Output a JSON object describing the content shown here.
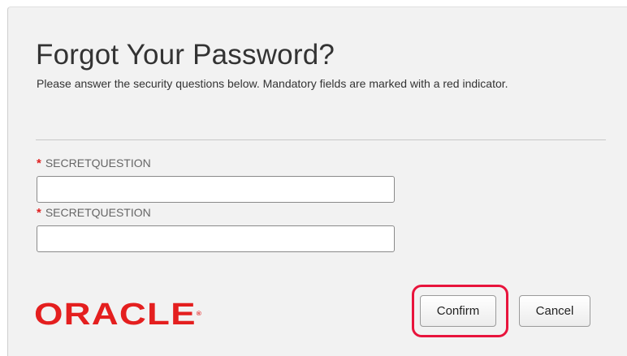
{
  "page": {
    "title": "Forgot Your Password?",
    "subtitle": "Please answer the security questions below. Mandatory fields are marked with a red indicator."
  },
  "form": {
    "required_marker": "*",
    "fields": [
      {
        "label": "SECRETQUESTION",
        "value": "",
        "placeholder": ""
      },
      {
        "label": "SECRETQUESTION",
        "value": "",
        "placeholder": ""
      }
    ]
  },
  "brand": {
    "logo_text": "ORACLE",
    "trademark": "®",
    "color": "#e41f1f"
  },
  "actions": {
    "confirm_label": "Confirm",
    "cancel_label": "Cancel"
  },
  "annotation": {
    "highlight_color": "#e8143c",
    "highlighted_element": "confirm-button"
  }
}
